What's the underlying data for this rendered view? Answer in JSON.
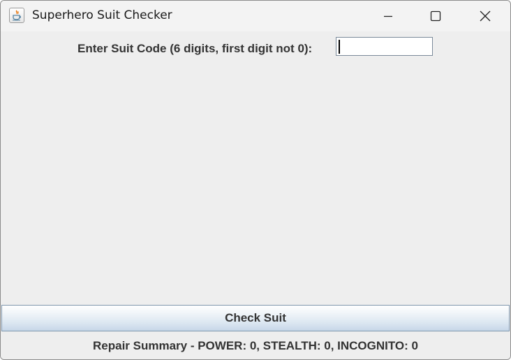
{
  "window": {
    "title": "Superhero Suit Checker",
    "icon": "java-cup-icon",
    "controls": [
      "minimize-icon",
      "maximize-icon",
      "close-icon"
    ]
  },
  "form": {
    "prompt_label": "Enter Suit Code (6 digits, first digit not 0):",
    "suit_code_value": "",
    "check_button_label": "Check Suit"
  },
  "summary": {
    "text": "Repair Summary - POWER: 0, STEALTH: 0, INCOGNITO: 0"
  },
  "colors": {
    "background": "#eeeeee",
    "titlebar": "#f3f3f3",
    "text": "#333333",
    "button_border": "#7f96ad"
  }
}
